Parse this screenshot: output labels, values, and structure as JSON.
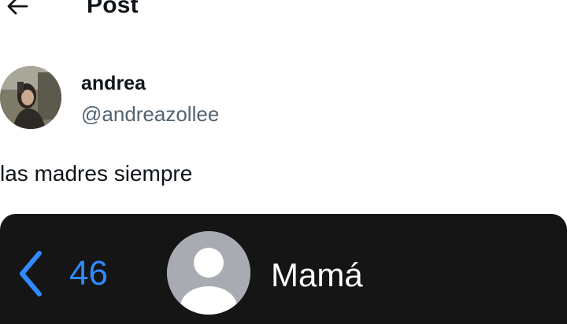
{
  "header": {
    "back_icon": "arrow-left-icon",
    "title": "Post"
  },
  "author": {
    "display_name": "andrea",
    "handle": "@andreazollee"
  },
  "post": {
    "text": "las madres siempre"
  },
  "embedded_screenshot": {
    "back_icon": "chevron-left-icon",
    "unread_count": "46",
    "contact_icon": "person-silhouette-icon",
    "contact_name": "Mamá",
    "accent_color": "#2f8bff"
  }
}
